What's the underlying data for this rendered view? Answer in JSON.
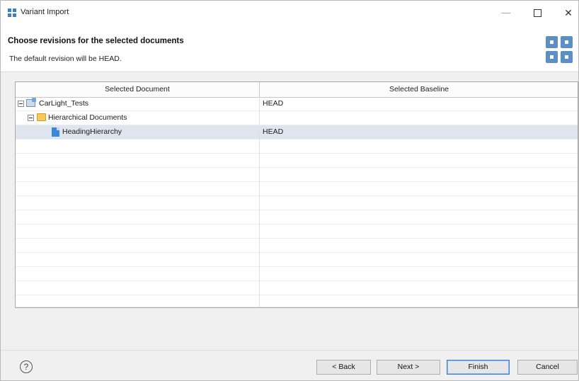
{
  "window": {
    "title": "Variant Import",
    "min_symbol": "—",
    "close_symbol": "✕"
  },
  "header": {
    "title": "Choose revisions for the selected documents",
    "description": "The default revision will be HEAD."
  },
  "table": {
    "columns": [
      "Selected Document",
      "Selected Baseline"
    ],
    "rows": [
      {
        "label": "CarLight_Tests",
        "baseline": "HEAD",
        "icon": "project-icon",
        "level": 0
      },
      {
        "label": "Hierarchical Documents",
        "baseline": "",
        "icon": "folder-icon",
        "level": 1
      },
      {
        "label": "HeadingHierarchy",
        "baseline": "HEAD",
        "icon": "document-icon",
        "level": 2,
        "selected": true
      }
    ]
  },
  "footer": {
    "help_symbol": "?",
    "back_label": "< Back",
    "next_label": "Next >",
    "finish_label": "Finish",
    "cancel_label": "Cancel"
  },
  "colors": {
    "selection": "#dfe5ee",
    "accent": "#3c7fd4",
    "folder": "#f5c95c",
    "document": "#3d88d6"
  }
}
